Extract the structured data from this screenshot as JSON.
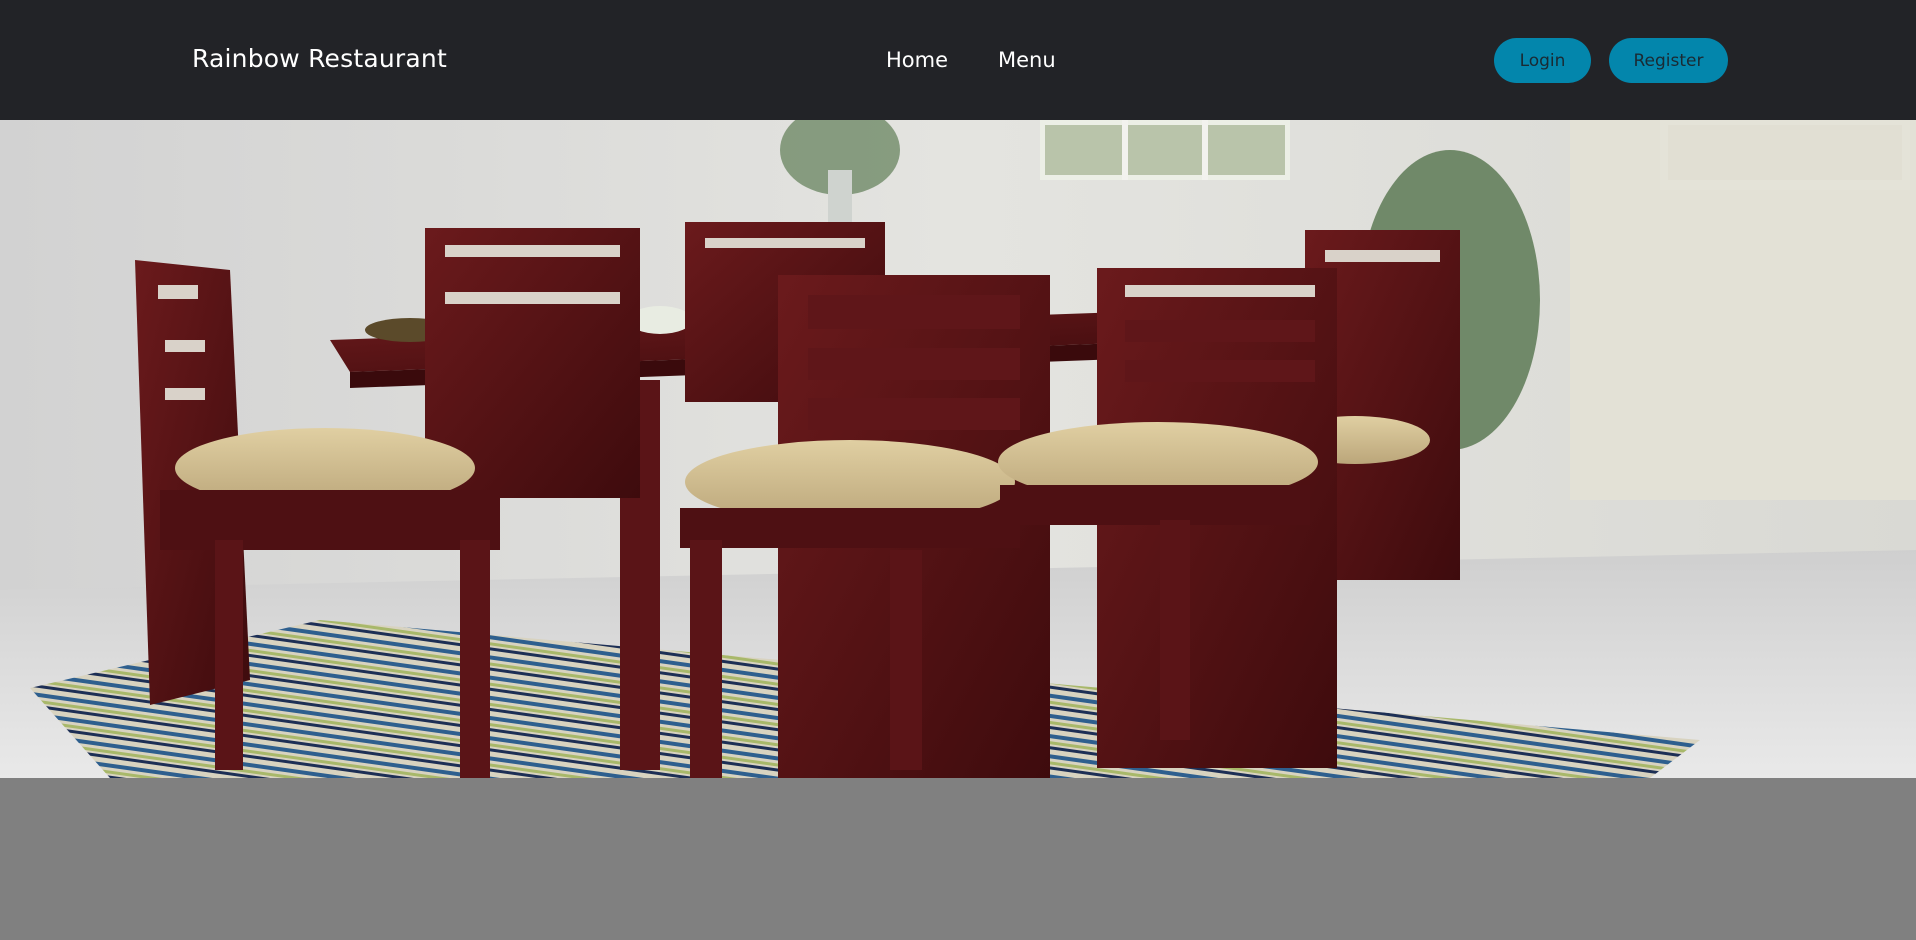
{
  "brand": {
    "name": "Rainbow Restaurant"
  },
  "nav": {
    "items": [
      {
        "label": "Home"
      },
      {
        "label": "Menu"
      }
    ]
  },
  "auth": {
    "login_label": "Login",
    "register_label": "Register"
  },
  "colors": {
    "navbar_bg": "#222327",
    "button_bg": "#0386ac",
    "page_bg": "#808080"
  },
  "hero": {
    "image_alt": "dining-room-with-table-and-chairs"
  }
}
